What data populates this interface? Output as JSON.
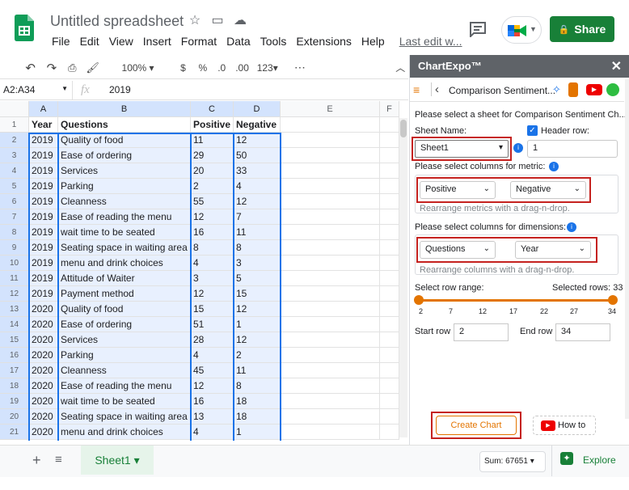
{
  "doc": {
    "title": "Untitled spreadsheet",
    "menu": [
      "File",
      "Edit",
      "View",
      "Insert",
      "Format",
      "Data",
      "Tools",
      "Extensions",
      "Help"
    ],
    "last_edit": "Last edit w..."
  },
  "share_label": "Share",
  "toolbar": {
    "zoom": "100%",
    "currency": "$",
    "percent": "%",
    "dec_less": ".0",
    "dec_more": ".00",
    "format": "123"
  },
  "formula": {
    "namebox": "A2:A34",
    "value": "2019"
  },
  "columns": [
    "A",
    "B",
    "C",
    "D",
    "E",
    "F"
  ],
  "rows": [
    {
      "n": "1",
      "a": "Year",
      "b": "Questions",
      "c": "Positive",
      "d": "Negative"
    },
    {
      "n": "2",
      "a": "2019",
      "b": "Quality of food",
      "c": "11",
      "d": "12"
    },
    {
      "n": "3",
      "a": "2019",
      "b": "Ease of ordering",
      "c": "29",
      "d": "50"
    },
    {
      "n": "4",
      "a": "2019",
      "b": "Services",
      "c": "20",
      "d": "33"
    },
    {
      "n": "5",
      "a": "2019",
      "b": "Parking",
      "c": "2",
      "d": "4"
    },
    {
      "n": "6",
      "a": "2019",
      "b": "Cleanness",
      "c": "55",
      "d": "12"
    },
    {
      "n": "7",
      "a": "2019",
      "b": "Ease of reading the menu",
      "c": "12",
      "d": "7"
    },
    {
      "n": "8",
      "a": "2019",
      "b": "wait time to be seated",
      "c": "16",
      "d": "11"
    },
    {
      "n": "9",
      "a": "2019",
      "b": "Seating space in waiting area",
      "c": "8",
      "d": "8"
    },
    {
      "n": "10",
      "a": "2019",
      "b": "menu and drink choices",
      "c": "4",
      "d": "3"
    },
    {
      "n": "11",
      "a": "2019",
      "b": "Attitude of Waiter",
      "c": "3",
      "d": "5"
    },
    {
      "n": "12",
      "a": "2019",
      "b": "Payment method",
      "c": "12",
      "d": "15"
    },
    {
      "n": "13",
      "a": "2020",
      "b": "Quality of food",
      "c": "15",
      "d": "12"
    },
    {
      "n": "14",
      "a": "2020",
      "b": "Ease of ordering",
      "c": "51",
      "d": "1"
    },
    {
      "n": "15",
      "a": "2020",
      "b": "Services",
      "c": "28",
      "d": "12"
    },
    {
      "n": "16",
      "a": "2020",
      "b": "Parking",
      "c": "4",
      "d": "2"
    },
    {
      "n": "17",
      "a": "2020",
      "b": "Cleanness",
      "c": "45",
      "d": "11"
    },
    {
      "n": "18",
      "a": "2020",
      "b": "Ease of reading the menu",
      "c": "12",
      "d": "8"
    },
    {
      "n": "19",
      "a": "2020",
      "b": "wait time to be seated",
      "c": "16",
      "d": "18"
    },
    {
      "n": "20",
      "a": "2020",
      "b": "Seating space in waiting area",
      "c": "13",
      "d": "18"
    },
    {
      "n": "21",
      "a": "2020",
      "b": "menu and drink choices",
      "c": "4",
      "d": "1"
    }
  ],
  "bottom": {
    "sheet_tab": "Sheet1",
    "sum": "Sum: 67651",
    "explore": "Explore"
  },
  "panel": {
    "title": "ChartExpo™",
    "close": "✕",
    "chart_name": "Comparison Sentiment...",
    "select_sheet": "Please select a sheet for Comparison Sentiment Ch...",
    "sheet_name_label": "Sheet Name:",
    "header_row_label": "Header row:",
    "sheet_value": "Sheet1",
    "header_row_value": "1",
    "metric_label": "Please select columns for metric:",
    "metric1": "Positive",
    "metric2": "Negative",
    "metric_hint": "Rearrange metrics with a drag-n-drop.",
    "dim_label": "Please select columns for dimensions:",
    "dim1": "Questions",
    "dim2": "Year",
    "dim_hint": "Rearrange columns with a drag-n-drop.",
    "row_range_label": "Select row range:",
    "selected_rows": "Selected rows: 33",
    "ticks": [
      "2",
      "7",
      "12",
      "17",
      "22",
      "27",
      "34"
    ],
    "start_row_label": "Start row",
    "start_row": "2",
    "end_row_label": "End row",
    "end_row": "34",
    "create_chart": "Create Chart",
    "how_to": "How to"
  }
}
